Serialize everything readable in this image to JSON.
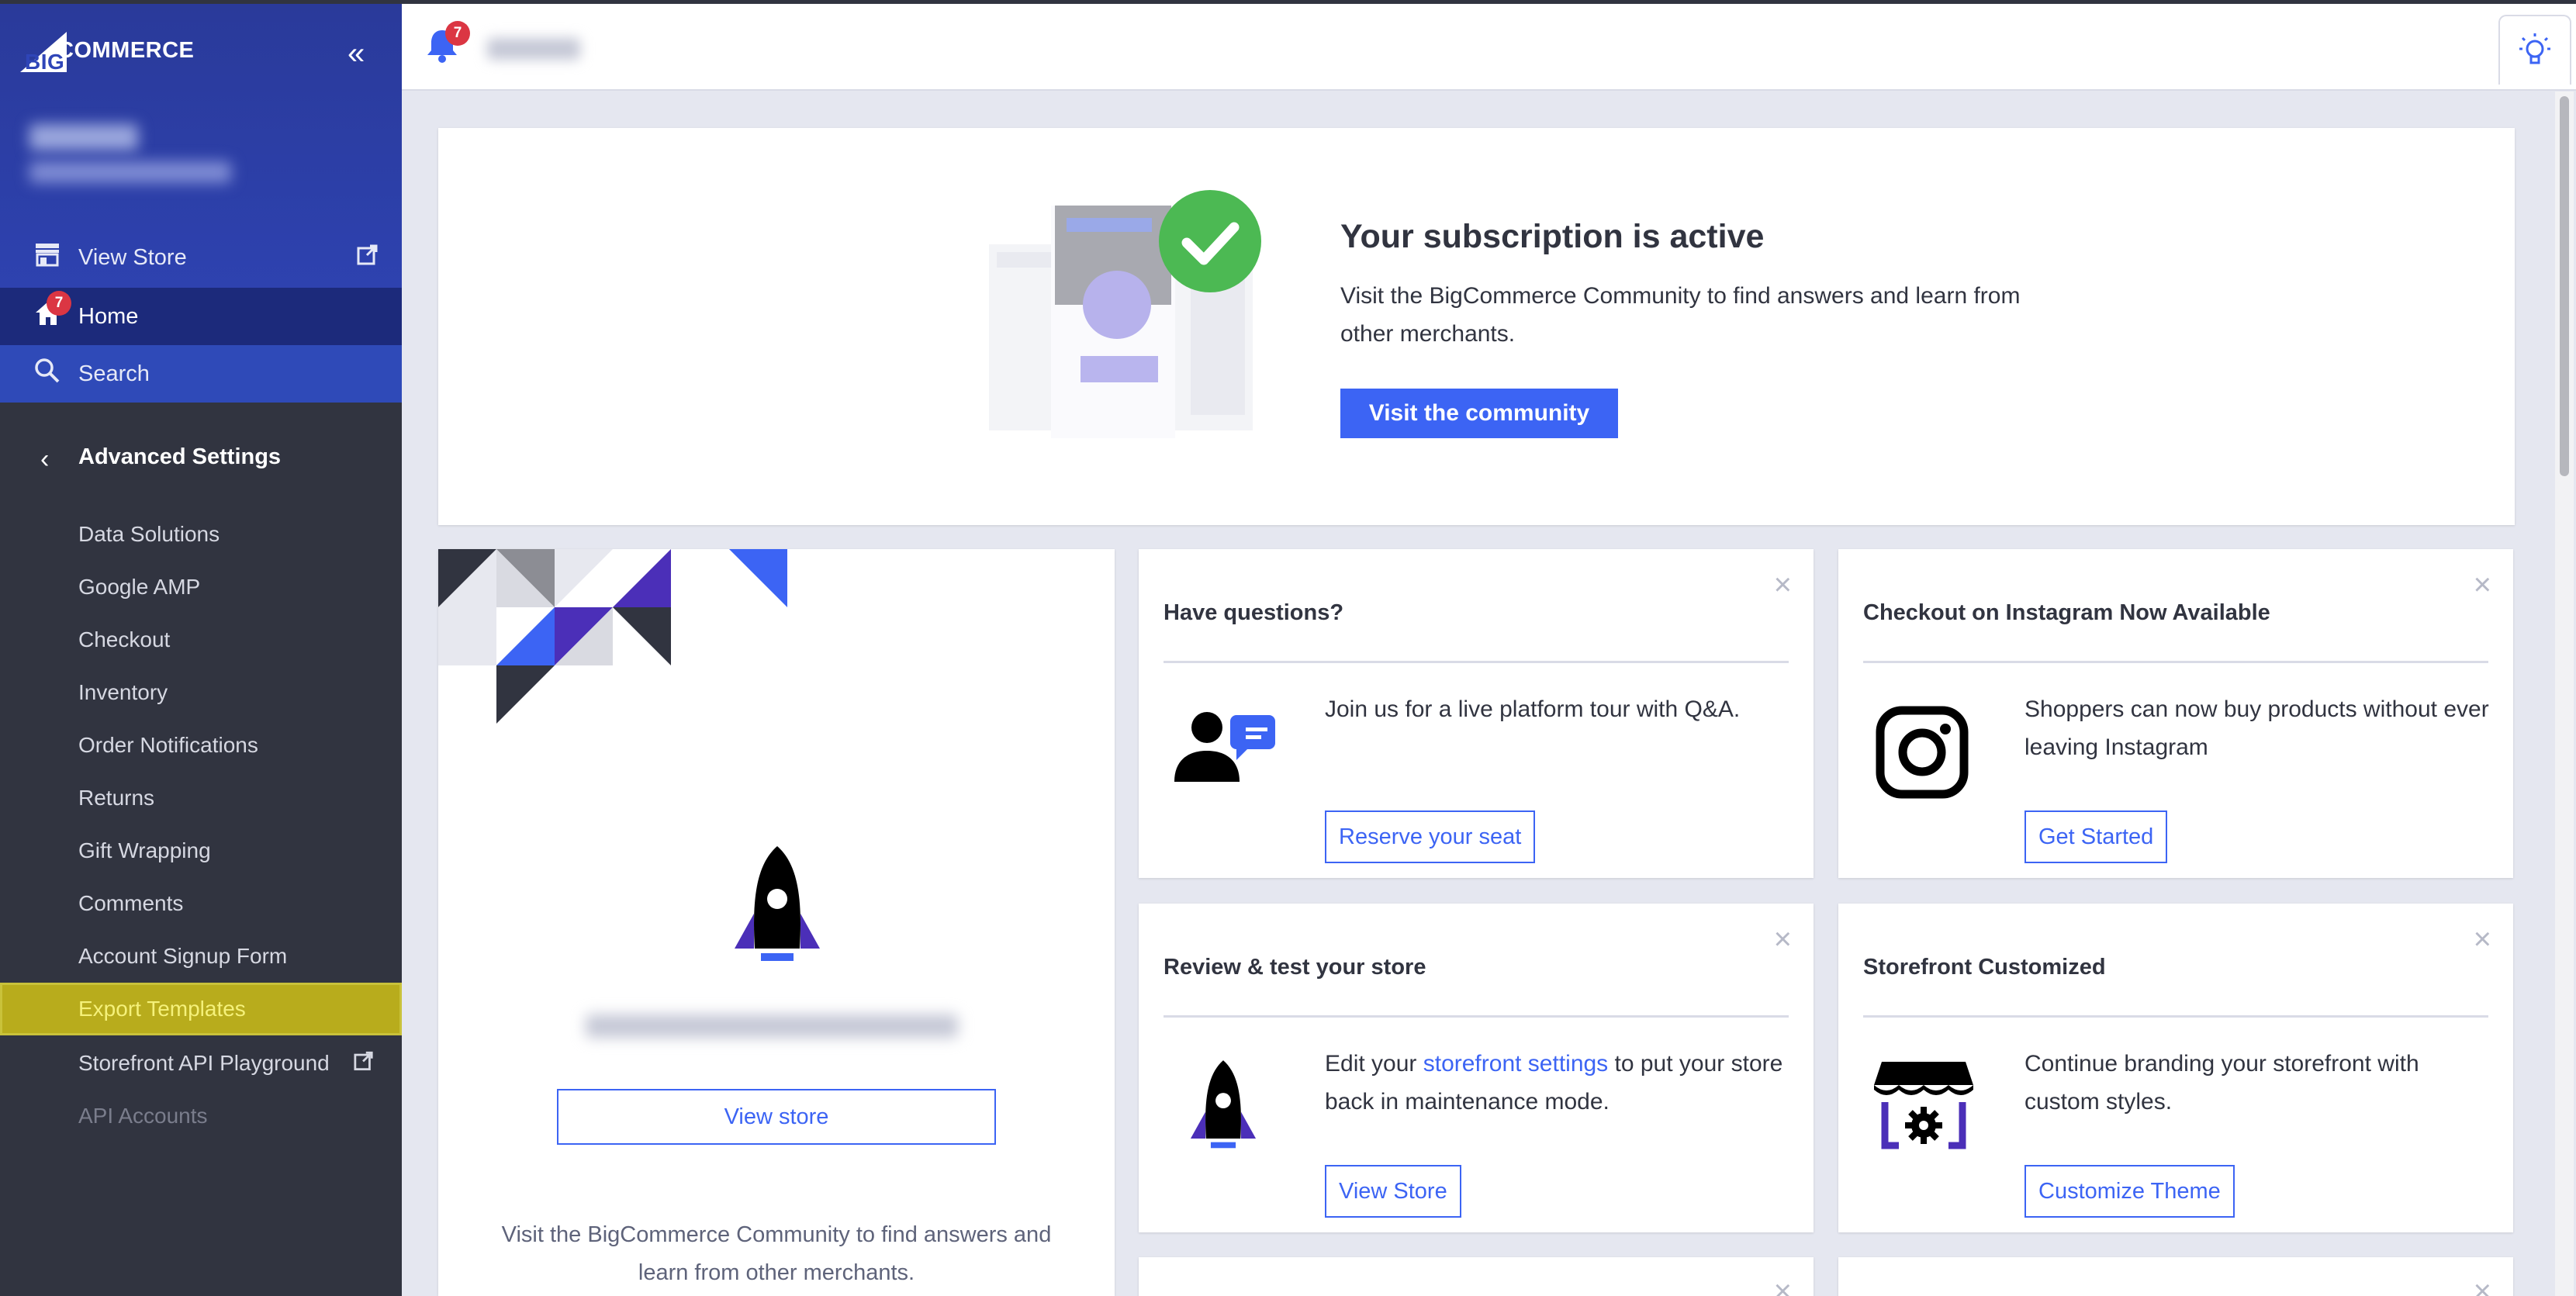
{
  "app": {
    "logo_text": "COMMERCE",
    "logo_prefix": "BIG"
  },
  "sidebar": {
    "view_store": "View Store",
    "home": "Home",
    "home_badge": "7",
    "search": "Search",
    "section_title": "Advanced Settings",
    "items": [
      {
        "label": "Data Solutions"
      },
      {
        "label": "Google AMP"
      },
      {
        "label": "Checkout"
      },
      {
        "label": "Inventory"
      },
      {
        "label": "Order Notifications"
      },
      {
        "label": "Returns"
      },
      {
        "label": "Gift Wrapping"
      },
      {
        "label": "Comments"
      },
      {
        "label": "Account Signup Form"
      },
      {
        "label": "Export Templates"
      },
      {
        "label": "Storefront API Playground"
      },
      {
        "label": "API Accounts"
      }
    ]
  },
  "header": {
    "notification_count": "7"
  },
  "hero": {
    "title": "Your subscription is active",
    "text": "Visit the BigCommerce Community to find answers and learn from other merchants.",
    "button": "Visit the community"
  },
  "big_card": {
    "button": "View store",
    "text": "Visit the BigCommerce Community to find answers and learn from other merchants."
  },
  "tiles": [
    {
      "title": "Have questions?",
      "body": "Join us for a live platform tour with Q&A.",
      "button": "Reserve your seat",
      "icon": "person-chat-icon"
    },
    {
      "title": "Checkout on Instagram Now Available",
      "body": "Shoppers can now buy products without ever leaving Instagram",
      "button": "Get Started",
      "icon": "instagram-icon"
    },
    {
      "title": "Review & test your store",
      "body_pre": "Edit your ",
      "body_link": "storefront settings",
      "body_post": " to put your store back in maintenance mode.",
      "button": "View Store",
      "icon": "rocket-icon"
    },
    {
      "title": "Storefront Customized",
      "body": "Continue branding your storefront with custom styles.",
      "button": "Customize Theme",
      "icon": "storefront-gear-icon"
    }
  ],
  "colors": {
    "primary": "#3c64f4",
    "sidebar": "#313440",
    "sidebar_top": "#2f45b8",
    "highlight": "#b8ac1c",
    "badge": "#db3643",
    "success": "#4cb953"
  }
}
